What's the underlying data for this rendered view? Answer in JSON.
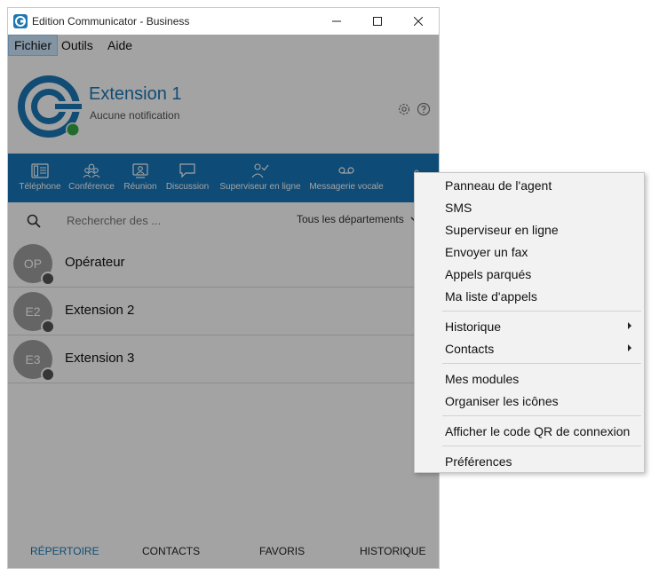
{
  "window": {
    "title": "Edition Communicator - Business"
  },
  "menu": {
    "items": [
      "Fichier",
      "Outils",
      "Aide"
    ]
  },
  "profile": {
    "name": "Extension 1",
    "status": "Aucune notification",
    "status_color": "#35a845"
  },
  "toolbar": {
    "color": "#1676b9",
    "items": [
      {
        "label": "Téléphone",
        "icon": "phone-icon"
      },
      {
        "label": "Conférence",
        "icon": "conference-icon"
      },
      {
        "label": "Réunion",
        "icon": "meeting-icon"
      },
      {
        "label": "Discussion",
        "icon": "chat-icon"
      },
      {
        "label": "Superviseur en ligne",
        "icon": "supervisor-icon"
      },
      {
        "label": "Messagerie vocale",
        "icon": "voicemail-icon"
      }
    ]
  },
  "search": {
    "placeholder": "Rechercher des ...",
    "department": "Tous les départements"
  },
  "contacts": [
    {
      "initials": "OP",
      "name": "Opérateur"
    },
    {
      "initials": "E2",
      "name": "Extension 2"
    },
    {
      "initials": "E3",
      "name": "Extension 3"
    }
  ],
  "bottom_nav": {
    "items": [
      "RÉPERTOIRE",
      "CONTACTS",
      "FAVORIS",
      "HISTORIQUE"
    ],
    "active": "RÉPERTOIRE"
  },
  "context_menu": {
    "items": [
      "Panneau de l'agent",
      "SMS",
      "Superviseur en ligne",
      "Envoyer un fax",
      "Appels parqués",
      "Ma liste d'appels",
      "Historique",
      "Contacts",
      "Mes modules",
      "Organiser les icônes",
      "Afficher le code QR de connexion",
      "Préférences"
    ]
  }
}
